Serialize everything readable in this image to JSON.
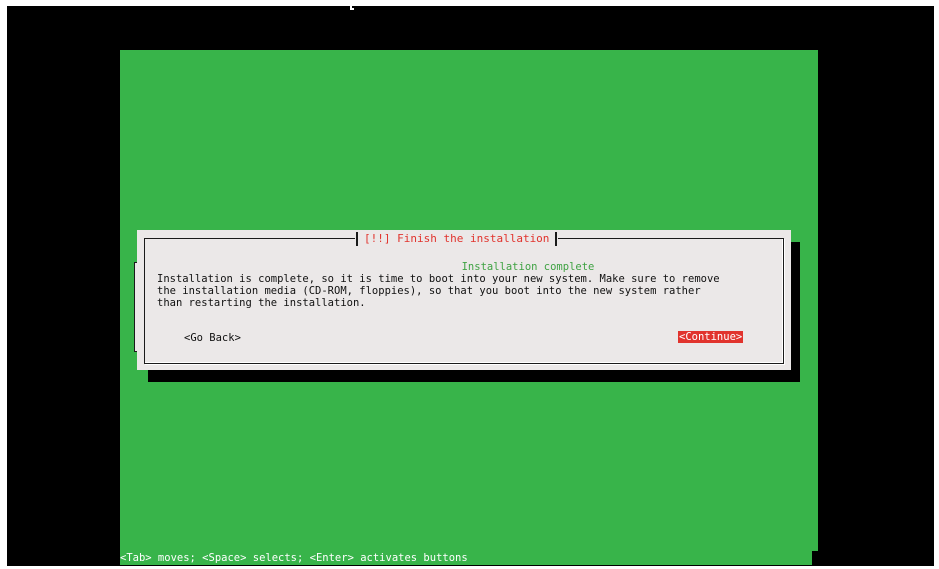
{
  "dialog": {
    "title": "[!!] Finish the installation",
    "subtitle": "Installation complete",
    "message_lines": [
      "Installation is complete, so it is time to boot into your new system. Make sure to remove",
      "the installation media (CD-ROM, floppies), so that you boot into the new system rather",
      "than restarting the installation."
    ],
    "buttons": {
      "back_label": "<Go Back>",
      "continue_label": "<Continue>"
    }
  },
  "statusbar": {
    "text": "<Tab> moves; <Space> selects; <Enter> activates buttons"
  },
  "colors": {
    "screen_background": "#38b44a",
    "dialog_background": "#ebe8e8",
    "title_text": "#e1332d",
    "subtitle_text": "#3fa243",
    "selected_button_background": "#e1332d"
  }
}
